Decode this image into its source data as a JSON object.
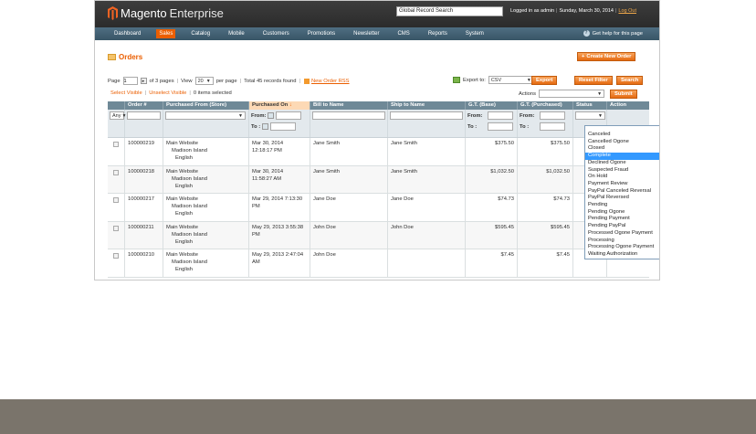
{
  "header": {
    "brand": "Magento",
    "edition": "Enterprise",
    "global_search": "Global Record Search",
    "logged_in": "Logged in as admin",
    "date": "Sunday, March 30, 2014",
    "logout": "Log Out"
  },
  "nav": {
    "items": [
      "Dashboard",
      "Sales",
      "Catalog",
      "Mobile",
      "Customers",
      "Promotions",
      "Newsletter",
      "CMS",
      "Reports",
      "System"
    ],
    "help": "Get help for this page"
  },
  "page": {
    "title": "Orders",
    "create_button": "Create New Order"
  },
  "pager": {
    "page_label": "Page",
    "page_value": "1",
    "of_pages": "of 3 pages",
    "view_label": "View",
    "view_value": "20",
    "per_page": "per page",
    "total": "Total 45 records found",
    "rss": "New Order RSS",
    "export_label": "Export to:",
    "export_format": "CSV",
    "export_button": "Export",
    "reset_button": "Reset Filter",
    "search_button": "Search"
  },
  "massaction": {
    "select_visible": "Select Visible",
    "unselect_visible": "Unselect Visible",
    "selected": "0 items selected",
    "actions_label": "Actions",
    "submit": "Submit"
  },
  "grid": {
    "headers": [
      "",
      "Order #",
      "Purchased From (Store)",
      "Purchased On",
      "Bill to Name",
      "Ship to Name",
      "G.T. (Base)",
      "G.T. (Purchased)",
      "Status",
      "Action"
    ],
    "filter": {
      "any": "Any",
      "from": "From:",
      "to": "To :"
    },
    "rows": [
      {
        "order": "100000219",
        "store1": "Main Website",
        "store2": "Madison Island",
        "store3": "English",
        "date1": "Mar 30, 2014",
        "date2": "12:18:17 PM",
        "bill": "Jane Smith",
        "ship": "Jane Smith",
        "base": "$375.50",
        "purchased": "$375.50"
      },
      {
        "order": "100000218",
        "store1": "Main Website",
        "store2": "Madison Island",
        "store3": "English",
        "date1": "Mar 30, 2014",
        "date2": "11:58:27 AM",
        "bill": "Jane Smith",
        "ship": "Jane Smith",
        "base": "$1,032.50",
        "purchased": "$1,032.50"
      },
      {
        "order": "100000217",
        "store1": "Main Website",
        "store2": "Madison Island",
        "store3": "English",
        "date1": "Mar 29, 2014 7:13:30",
        "date2": "PM",
        "bill": "Jane Doe",
        "ship": "Jane Doe",
        "base": "$74.73",
        "purchased": "$74.73"
      },
      {
        "order": "100000211",
        "store1": "Main Website",
        "store2": "Madison Island",
        "store3": "English",
        "date1": "May 29, 2013 3:55:38",
        "date2": "PM",
        "bill": "John Doe",
        "ship": "John Doe",
        "base": "$595.45",
        "purchased": "$595.45"
      },
      {
        "order": "100000210",
        "store1": "Main Website",
        "store2": "Madison Island",
        "store3": "English",
        "date1": "May 29, 2013 2:47:04",
        "date2": "AM",
        "bill": "John Doe",
        "ship": "",
        "base": "$7.45",
        "purchased": "$7.45"
      }
    ]
  },
  "status_options": [
    "Canceled",
    "Cancelled Ogone",
    "Closed",
    "Complete",
    "Declined Ogone",
    "Suspected Fraud",
    "On Hold",
    "Payment Review",
    "PayPal Canceled Reversal",
    "PayPal Reversed",
    "Pending",
    "Pending Ogone",
    "Pending Payment",
    "Pending PayPal",
    "Processed Ogone Payment",
    "Processing",
    "Processing Ogone Payment",
    "Waiting Authorization"
  ],
  "status_highlighted": "Complete",
  "colors": {
    "accent": "#eb5e00",
    "header": "#2b2b2b",
    "nav": "#385566",
    "grid_header": "#6f8997",
    "bottom_bar": "#7a746b"
  }
}
